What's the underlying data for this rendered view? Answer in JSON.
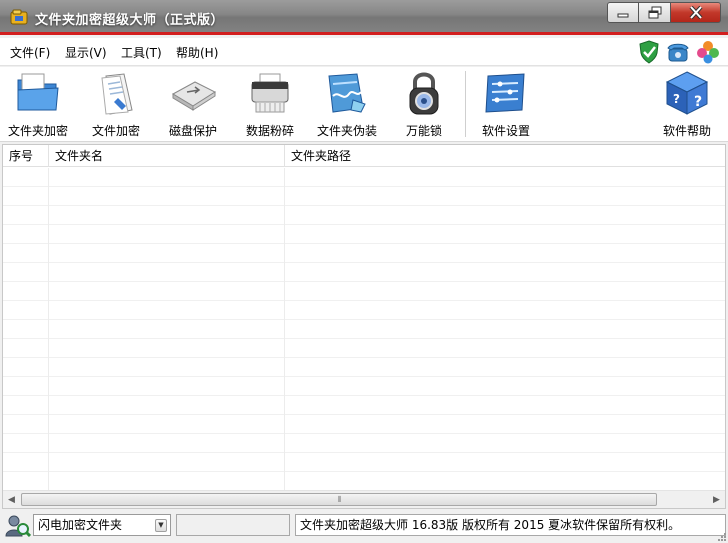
{
  "window": {
    "title": "文件夹加密超级大师（正式版）",
    "accent_color": "#d21f1f"
  },
  "menu": {
    "items": [
      {
        "label": "文件(F)"
      },
      {
        "label": "显示(V)"
      },
      {
        "label": "工具(T)"
      },
      {
        "label": "帮助(H)"
      }
    ],
    "status_icons": [
      "shield-check-icon",
      "telephone-icon",
      "clover-icon"
    ]
  },
  "toolbar": {
    "tools": [
      {
        "label": "文件夹加密",
        "icon": "folder-encrypt-icon"
      },
      {
        "label": "文件加密",
        "icon": "file-encrypt-icon"
      },
      {
        "label": "磁盘保护",
        "icon": "usb-drive-icon"
      },
      {
        "label": "数据粉碎",
        "icon": "shredder-icon"
      },
      {
        "label": "文件夹伪装",
        "icon": "folder-disguise-icon"
      },
      {
        "label": "万能锁",
        "icon": "padlock-icon"
      },
      {
        "label": "软件设置",
        "icon": "settings-panel-icon"
      },
      {
        "label": "软件帮助",
        "icon": "help-cube-icon"
      }
    ]
  },
  "list": {
    "columns": [
      "序号",
      "文件夹名",
      "文件夹路径"
    ],
    "rows": []
  },
  "statusbar": {
    "mode_select": "闪电加密文件夹",
    "info": "文件夹加密超级大师 16.83版 版权所有 2015 夏冰软件保留所有权利。"
  }
}
